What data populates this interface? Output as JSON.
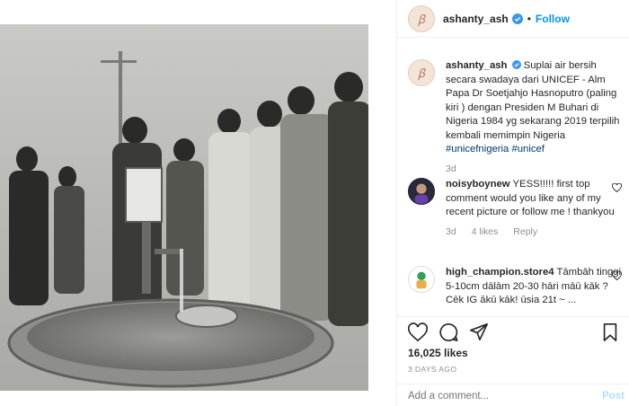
{
  "post": {
    "username": "ashanty_ash",
    "follow_label": "Follow",
    "dot": "•",
    "avatar_icon": "avatar-logo-icon"
  },
  "comments": [
    {
      "username": "ashanty_ash",
      "text": "Suplai air bersih secara swadaya dari UNICEF - Alm Papa Dr Soetjahjo Hasnoputro (paling kiri ) dengan Presiden M Buhari di Nigeria 1984 yg sekarang 2019 terpilih kembali memimpin Nigeria",
      "tags": "#unicefnigeria #unicef",
      "time": "3d"
    },
    {
      "username": "noisyboynew",
      "text": "YESS!!!!! first top comment would you like any of my recent picture or follow me ! thankyou",
      "time": "3d",
      "likes": "4 likes",
      "reply_label": "Reply"
    },
    {
      "username": "high_champion.store4",
      "text": "Tāmbāh tinggi 5-10cm dālām 20-30 hāri māū kāk ? Cēk IG ākū kāk! ūsia 21t ~ ...",
      "partial": "..."
    }
  ],
  "actions": {
    "icons": [
      "heart-icon",
      "comment-icon",
      "share-icon",
      "bookmark-icon"
    ]
  },
  "likes": "16,025 likes",
  "posted_ago": "3 DAYS AGO",
  "add_comment": {
    "placeholder": "Add a comment...",
    "post_label": "Post"
  },
  "colors": {
    "accent": "#0095f6",
    "muted": "#8e8e8e",
    "border": "#efefef",
    "post_disabled": "#b2dffc"
  }
}
